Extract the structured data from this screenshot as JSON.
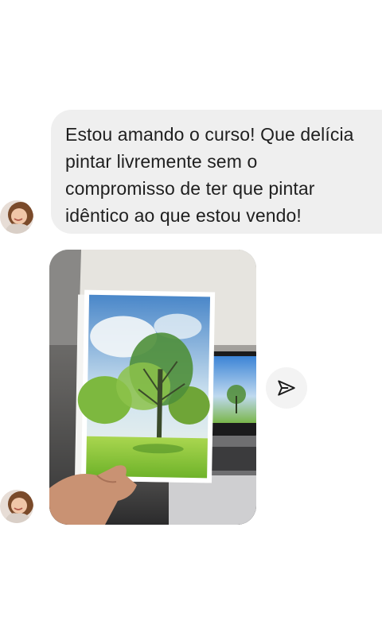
{
  "message": {
    "text": "Estou amando o curso! Que delícia\npintar livremente sem o\ncompromisso de ter que pintar\nidêntico ao que estou vendo!"
  },
  "avatar": {
    "icon": "person-avatar"
  },
  "photo": {
    "icon": "painting-photo"
  },
  "share": {
    "icon": "send-icon"
  },
  "colors": {
    "bubble": "#efefef",
    "text": "#1f1f1f",
    "background": "#ffffff"
  }
}
